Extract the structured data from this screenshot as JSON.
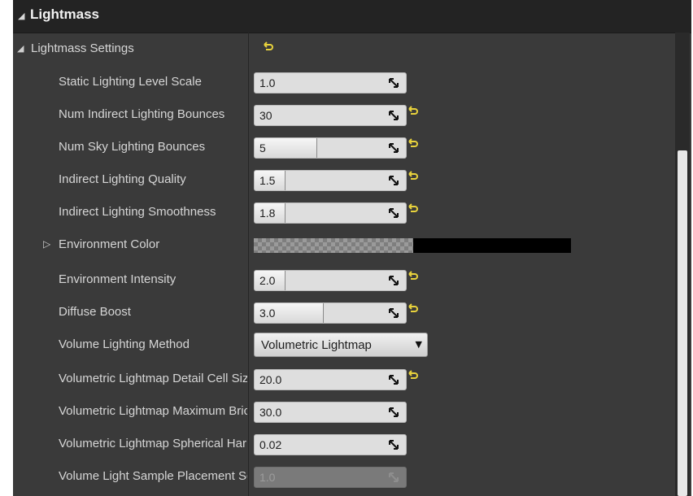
{
  "section": {
    "title": "Lightmass"
  },
  "category": {
    "title": "Lightmass Settings"
  },
  "properties": [
    {
      "label": "Static Lighting Level Scale",
      "value": "1.0",
      "fill": 0,
      "reset": false
    },
    {
      "label": "Num Indirect Lighting Bounces",
      "value": "30",
      "fill": 0,
      "reset": true
    },
    {
      "label": "Num Sky Lighting Bounces",
      "value": "5",
      "fill": 0.41,
      "reset": true
    },
    {
      "label": "Indirect Lighting Quality",
      "value": "1.5",
      "fill": 0.2,
      "reset": true
    },
    {
      "label": "Indirect Lighting Smoothness",
      "value": "1.8",
      "fill": 0.2,
      "reset": true
    },
    {
      "label": "Environment Intensity",
      "value": "2.0",
      "fill": 0.2,
      "reset": true
    },
    {
      "label": "Diffuse Boost",
      "value": "3.0",
      "fill": 0.45,
      "reset": true
    },
    {
      "label": "Volumetric Lightmap Detail Cell Size",
      "value": "20.0",
      "fill": 0,
      "reset": true
    },
    {
      "label": "Volumetric Lightmap Maximum Brick Memory Mb",
      "value": "30.0",
      "fill": 0,
      "reset": false
    },
    {
      "label": "Volumetric Lightmap Spherical Harmonic Smoothing",
      "value": "0.02",
      "fill": 0,
      "reset": false
    },
    {
      "label": "Volume Light Sample Placement Scale",
      "value": "1.0",
      "fill": 0,
      "reset": false
    }
  ],
  "environment_color": {
    "label": "Environment Color",
    "color": "#000000"
  },
  "volume_method": {
    "label": "Volume Lighting Method",
    "value": "Volumetric Lightmap"
  },
  "colors": {
    "panel": "#3a3a3a",
    "header": "#232323",
    "reset_icon": "#e8d23c",
    "field": "#dedede"
  }
}
